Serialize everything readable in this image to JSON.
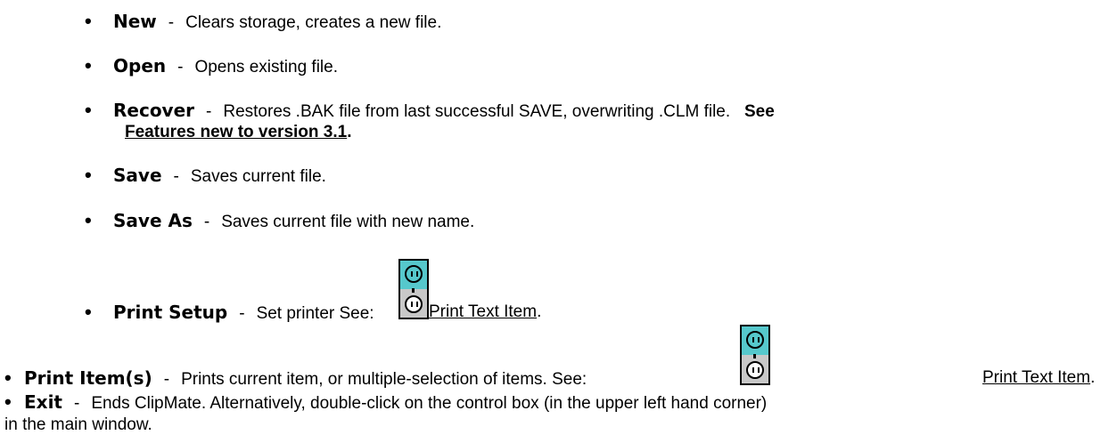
{
  "items": [
    {
      "term": "New",
      "sep": "-",
      "desc": "Clears storage, creates a new file."
    },
    {
      "term": "Open",
      "sep": "-",
      "desc": "Opens existing file."
    },
    {
      "term": "Recover",
      "sep": "-",
      "desc": "Restores .BAK file from last successful SAVE, overwriting .CLM file.",
      "see": "See",
      "link": "Features new to version 3.1",
      "link_suffix": "."
    },
    {
      "term": "Save",
      "sep": "-",
      "desc": "Saves current file."
    },
    {
      "term": "Save As",
      "sep": "-",
      "desc": "Saves current file with new name."
    },
    {
      "term": "Print Setup",
      "sep": "-",
      "desc": "Set printer   See:",
      "link": " Print Text Item",
      "link_suffix": "."
    },
    {
      "term": "Print Item(s)",
      "sep": "-",
      "desc": "Prints current item, or multiple-selection of items.   See:",
      "link": "Print Text Item",
      "link_suffix": "."
    },
    {
      "term": "Exit",
      "sep": "-",
      "desc": "Ends ClipMate.  Alternatively, double-click on the control box (in the upper left hand corner)",
      "desc_cont": "in the main window."
    }
  ],
  "icons": {
    "outlet": "electrical-outlet-icon",
    "colors": {
      "top": "#56c8cc",
      "body": "#c8c8c8"
    }
  }
}
